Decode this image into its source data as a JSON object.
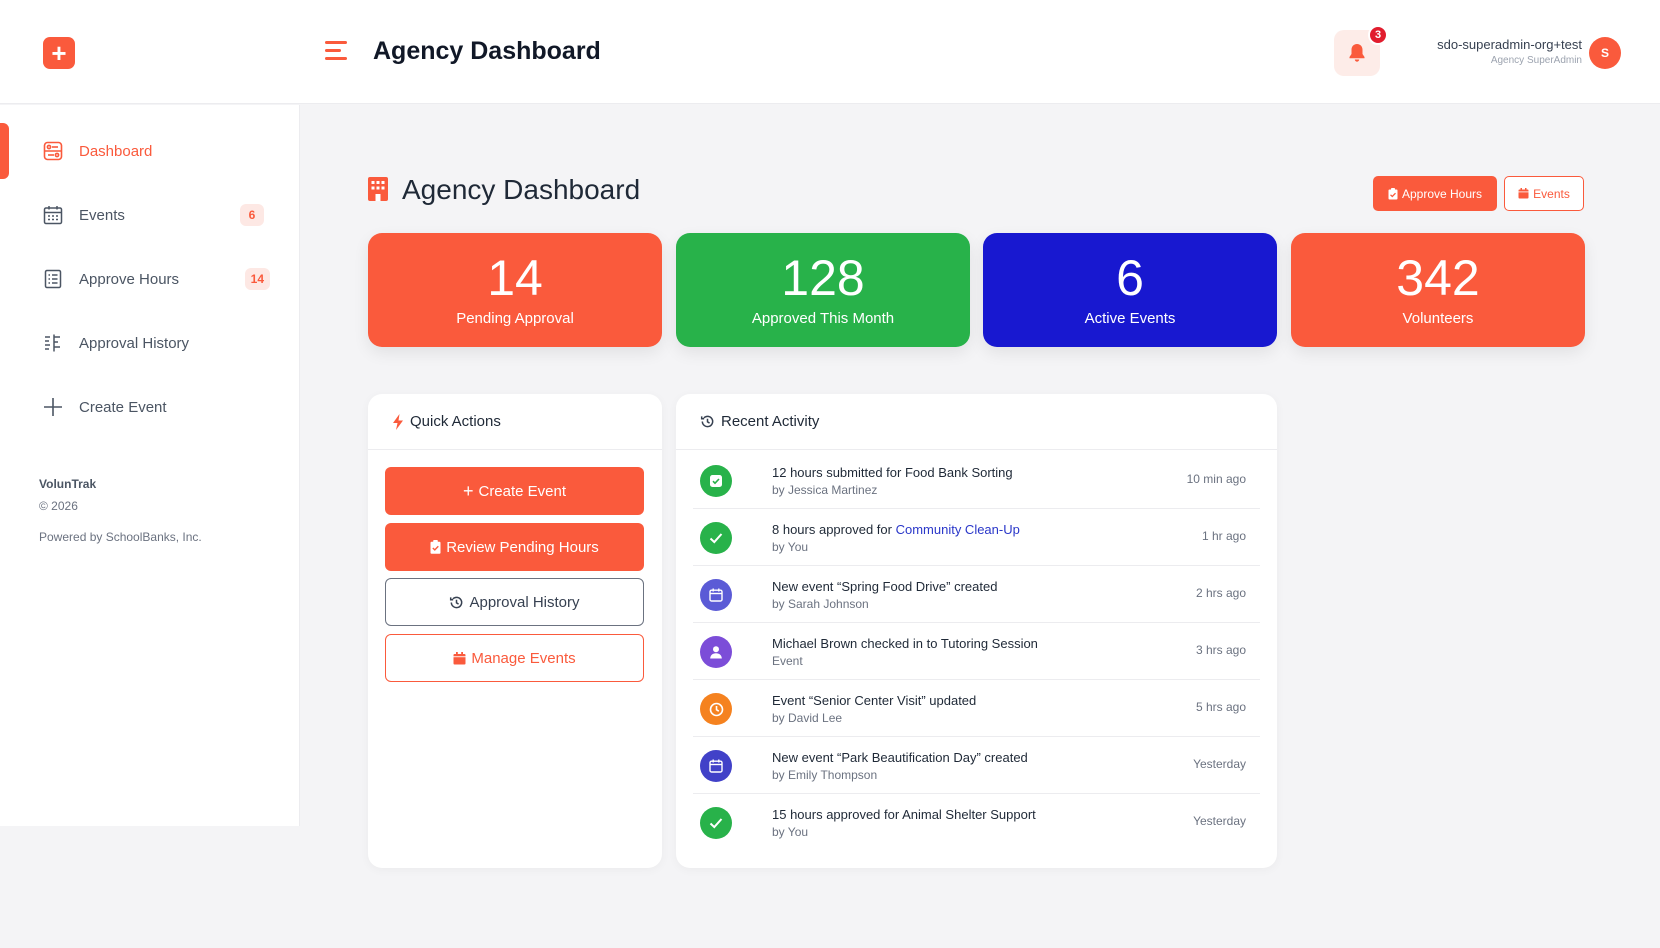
{
  "header": {
    "title": "Agency Dashboard",
    "notification_count": "3",
    "user_name": "sdo-superadmin-org+test",
    "user_role": "Agency SuperAdmin",
    "avatar_initial": "S"
  },
  "sidebar": {
    "items": [
      {
        "label": "Dashboard",
        "icon": "dashboard-icon",
        "badge": null,
        "active": true
      },
      {
        "label": "Events",
        "icon": "calendar-icon",
        "badge": "6"
      },
      {
        "label": "Approve Hours",
        "icon": "list-icon",
        "badge": "14"
      },
      {
        "label": "Approval History",
        "icon": "history-list-icon",
        "badge": null
      },
      {
        "label": "Create Event",
        "icon": "plus-icon",
        "badge": null
      }
    ],
    "brand": "VolunTrak",
    "copyright": "© 2026",
    "powered_by": "Powered by SchoolBanks, Inc."
  },
  "page": {
    "title": "Agency Dashboard",
    "approve_button": "Approve Hours",
    "events_button": "Events"
  },
  "stats": [
    {
      "value": "14",
      "label": "Pending Approval",
      "color": "#fa5a3c"
    },
    {
      "value": "128",
      "label": "Approved This Month",
      "color": "#28b24a"
    },
    {
      "value": "6",
      "label": "Active Events",
      "color": "#1818d0"
    },
    {
      "value": "342",
      "label": "Volunteers",
      "color": "#fa5a3c"
    }
  ],
  "quick_actions": {
    "title": "Quick Actions",
    "buttons": [
      {
        "label": "Create Event"
      },
      {
        "label": "Review Pending Hours"
      },
      {
        "label": "Approval History"
      },
      {
        "label": "Manage Events"
      }
    ]
  },
  "recent_activity": {
    "title": "Recent Activity",
    "items": [
      {
        "title": "12 hours submitted for Food Bank Sorting",
        "title_pre": "",
        "title_hl": "",
        "sub": "by Jessica Martinez",
        "time": "10 min ago",
        "icon": "check-square-icon",
        "color": "#28b24a"
      },
      {
        "title": "",
        "title_pre": "8 hours approved for ",
        "title_hl": "Community Clean-Up",
        "sub": "by You",
        "time": "1 hr ago",
        "icon": "check-icon",
        "color": "#28b24a"
      },
      {
        "title": "New event “Spring Food Drive” created",
        "title_pre": "",
        "title_hl": "",
        "sub": "by Sarah Johnson",
        "time": "2 hrs ago",
        "icon": "calendar-icon",
        "color": "#5b5bd6"
      },
      {
        "title": "Michael Brown checked in to Tutoring Session",
        "title_pre": "",
        "title_hl": "",
        "sub": "Event",
        "time": "3 hrs ago",
        "icon": "user-icon",
        "color": "#7c4dd8"
      },
      {
        "title": "Event “Senior Center Visit” updated",
        "title_pre": "",
        "title_hl": "",
        "sub": "by David Lee",
        "time": "5 hrs ago",
        "icon": "clock-icon",
        "color": "#f5821f"
      },
      {
        "title": "New event “Park Beautification Day” created",
        "title_pre": "",
        "title_hl": "",
        "sub": "by Emily Thompson",
        "time": "Yesterday",
        "icon": "calendar-icon",
        "color": "#4141c8"
      },
      {
        "title": "15 hours approved for Animal Shelter Support",
        "title_pre": "",
        "title_hl": "",
        "sub": "by You",
        "time": "Yesterday",
        "icon": "check-icon",
        "color": "#28b24a"
      }
    ]
  },
  "colors": {
    "accent": "#fa5a3c",
    "link": "#2a37c9"
  }
}
